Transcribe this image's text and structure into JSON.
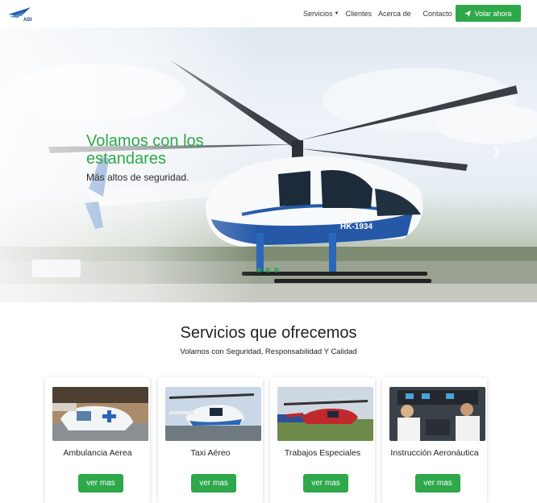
{
  "nav": {
    "logo_text": "ADI",
    "links": [
      "Servicios",
      "Clientes",
      "Acerca de",
      "Contacto"
    ],
    "cta_label": "Volar ahora"
  },
  "hero": {
    "title": "Volamos con los estandares",
    "subtitle": "Más altos de seguridad.",
    "registration": "HK-1934",
    "slide_count": 3
  },
  "services": {
    "title": "Servicios que ofrecemos",
    "subtitle": "Volamos con Seguridad, Responsabilidad Y Calidad",
    "cards": [
      {
        "label": "Ambulancia Aerea",
        "button": "ver mas"
      },
      {
        "label": "Taxi Aéreo",
        "button": "ver mas"
      },
      {
        "label": "Trabajos Especiales",
        "button": "ver mas"
      },
      {
        "label": "Instrucción Aeronáutica",
        "button": "ver mas"
      }
    ]
  },
  "colors": {
    "accent": "#2ea84a",
    "text": "#222222"
  }
}
